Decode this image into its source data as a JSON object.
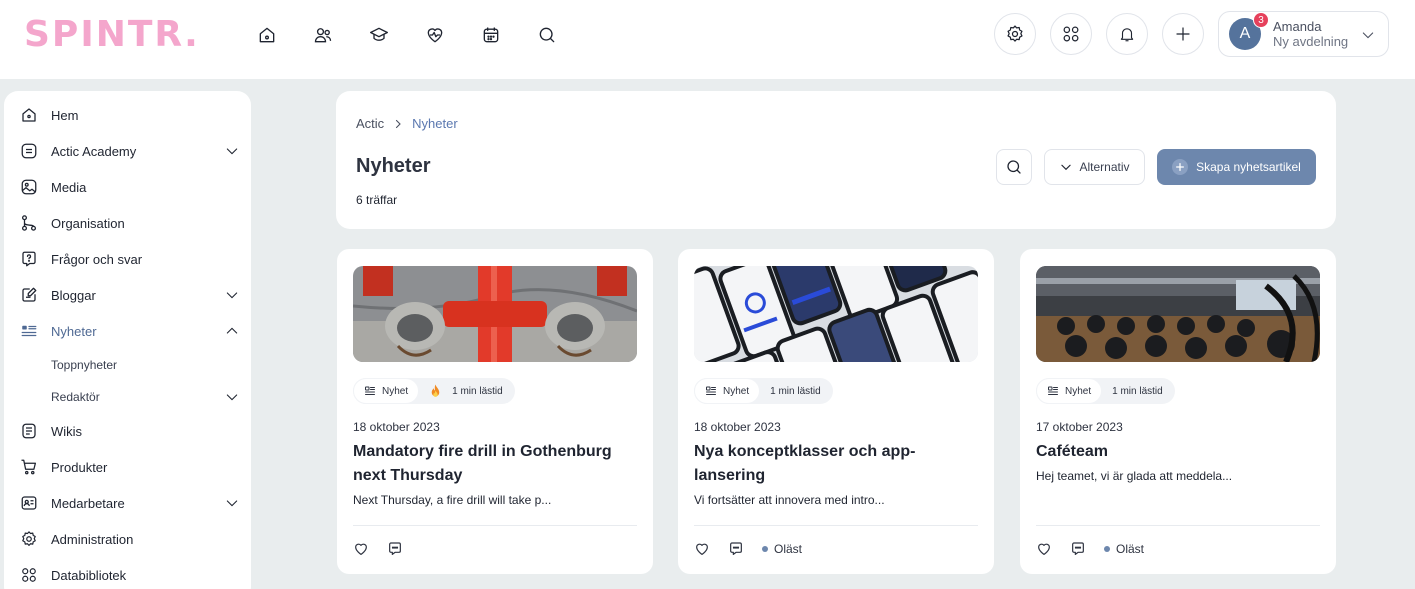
{
  "brand": {
    "logo_text": "SPINTR",
    "logo_dot": ".",
    "color": "#f4a6cc"
  },
  "topnav": {
    "icons": [
      "home-icon",
      "people-icon",
      "academy-icon",
      "heart-pulse-icon",
      "calendar-icon",
      "search-icon"
    ]
  },
  "topright": {
    "icons": [
      "gear-icon",
      "apps-grid-icon",
      "bell-icon",
      "plus-icon"
    ],
    "user": {
      "initial": "A",
      "name": "Amanda",
      "department": "Ny avdelning",
      "notification_count": "3"
    }
  },
  "sidebar": {
    "items": [
      {
        "label": "Hem",
        "icon": "home-icon"
      },
      {
        "label": "Actic Academy",
        "icon": "academy-icon",
        "expandable": true
      },
      {
        "label": "Media",
        "icon": "image-icon"
      },
      {
        "label": "Organisation",
        "icon": "org-chart-icon"
      },
      {
        "label": "Frågor och svar",
        "icon": "question-icon"
      },
      {
        "label": "Bloggar",
        "icon": "blog-icon",
        "expandable": true
      },
      {
        "label": "Nyheter",
        "icon": "news-icon",
        "expandable": true,
        "expanded": true,
        "active": true
      },
      {
        "label": "Wikis",
        "icon": "wiki-icon"
      },
      {
        "label": "Produkter",
        "icon": "cart-icon"
      },
      {
        "label": "Medarbetare",
        "icon": "contact-card-icon",
        "expandable": true
      },
      {
        "label": "Administration",
        "icon": "gear-icon"
      },
      {
        "label": "Databibliotek",
        "icon": "grid-icon"
      }
    ],
    "subitems": [
      {
        "label": "Toppnyheter"
      },
      {
        "label": "Redaktör",
        "expandable": true
      }
    ]
  },
  "header": {
    "breadcrumb_root": "Actic",
    "breadcrumb_current": "Nyheter",
    "title": "Nyheter",
    "hits": "6 träffar",
    "options_label": "Alternativ",
    "create_label": "Skapa nyhetsartikel"
  },
  "news": [
    {
      "tag_type": "Nyhet",
      "hot": true,
      "read_time": "1 min lästid",
      "date": "18 oktober 2023",
      "title": "Mandatory fire drill in Gothenburg next Thursday",
      "excerpt": "Next Thursday, a fire drill will take p...",
      "unread": ""
    },
    {
      "tag_type": "Nyhet",
      "hot": false,
      "read_time": "1 min lästid",
      "date": "18 oktober 2023",
      "title": "Nya konceptklasser och app-lansering",
      "excerpt": "Vi fortsätter att innovera med intro...",
      "unread": "Oläst"
    },
    {
      "tag_type": "Nyhet",
      "hot": false,
      "read_time": "1 min lästid",
      "date": "17 oktober 2023",
      "title": "Caféteam",
      "excerpt": "Hej teamet, vi är glada att meddela...",
      "unread": "Oläst"
    }
  ],
  "colors": {
    "accent": "#6d87ad",
    "active_text": "#4f6993",
    "breadcrumb_active": "#5b78b0",
    "badge": "#e6415c",
    "background": "#e9edee"
  }
}
